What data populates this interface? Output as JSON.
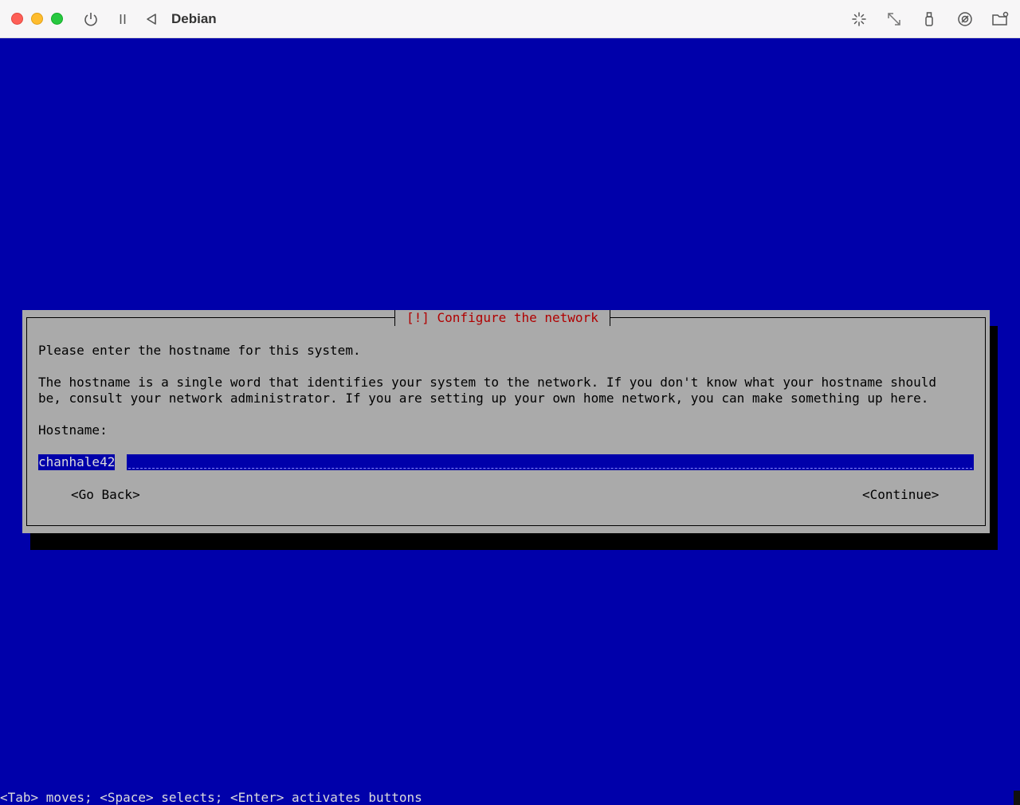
{
  "window": {
    "title": "Debian",
    "toolbar_icons": [
      "power-icon",
      "pause-icon",
      "back-icon",
      "capture-icon",
      "resize-icon",
      "usb-icon",
      "audio-icon",
      "shared-folder-icon"
    ]
  },
  "dialog": {
    "title": "[!] Configure the network",
    "prompt": "Please enter the hostname for this system.",
    "description_line1": "The hostname is a single word that identifies your system to the network. If you don't know what your hostname should",
    "description_line2": "be, consult your network administrator. If you are setting up your own home network, you can make something up here.",
    "field_label": "Hostname:",
    "field_value": "chanhale42",
    "go_back_label": "<Go Back>",
    "continue_label": "<Continue>"
  },
  "statusbar": {
    "hint": "<Tab> moves; <Space> selects; <Enter> activates buttons"
  },
  "colors": {
    "screen_bg": "#0000aa",
    "dialog_bg": "#aaaaaa",
    "title_text": "#b00000"
  }
}
